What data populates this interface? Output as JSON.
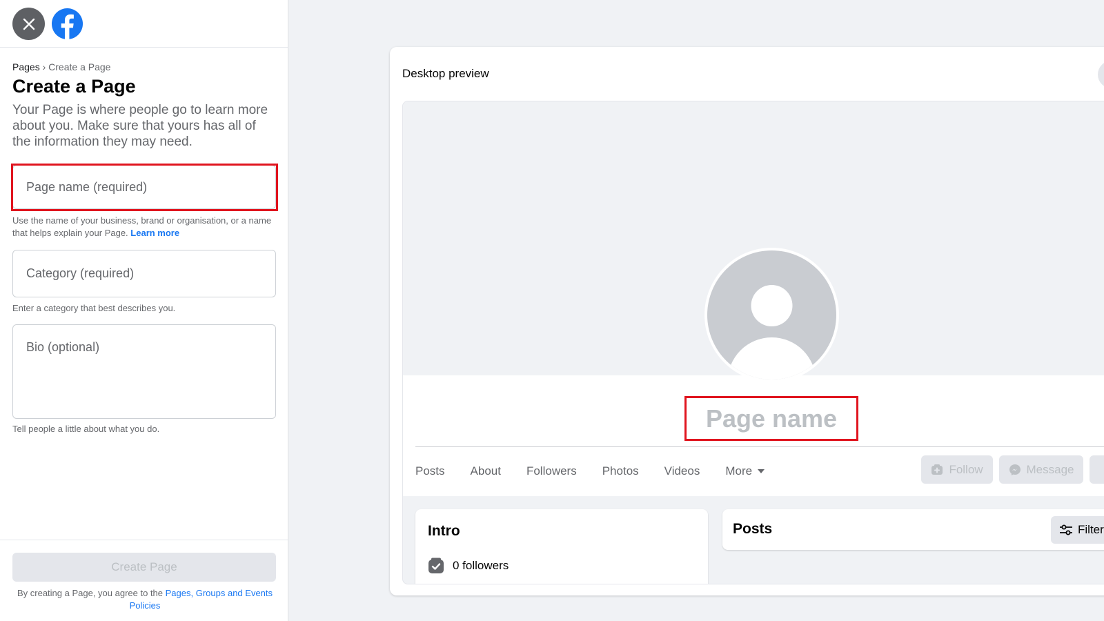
{
  "sidebar": {
    "breadcrumb": {
      "root": "Pages",
      "separator": "›",
      "current": "Create a Page"
    },
    "title": "Create a Page",
    "description": "Your Page is where people go to learn more about you. Make sure that yours has all of the information they may need.",
    "page_name": {
      "placeholder": "Page name (required)",
      "value": ""
    },
    "page_name_help": "Use the name of your business, brand or organisation, or a name that helps explain your Page.",
    "page_name_help_link": "Learn more",
    "category": {
      "placeholder": "Category (required)",
      "value": ""
    },
    "category_help": "Enter a category that best describes you.",
    "bio": {
      "placeholder": "Bio (optional)",
      "value": ""
    },
    "bio_help": "Tell people a little about what you do.",
    "create_button": "Create Page",
    "terms_prefix": "By creating a Page, you agree to the",
    "terms_link": "Pages, Groups and Events Policies"
  },
  "preview": {
    "title": "Desktop preview",
    "page_name": "Page name",
    "tabs": [
      "Posts",
      "About",
      "Followers",
      "Photos",
      "Videos"
    ],
    "more_tab": "More",
    "follow_button": "Follow",
    "message_button": "Message",
    "intro_title": "Intro",
    "followers_text": "0 followers",
    "posts_title": "Posts",
    "filters_button": "Filters"
  },
  "icons": {
    "close": "close-icon",
    "logo": "facebook-logo-icon",
    "avatar": "default-avatar-icon",
    "follow": "follow-icon",
    "message": "messenger-icon",
    "followers": "followers-check-icon",
    "filters": "filters-sliders-icon"
  },
  "colors": {
    "brand": "#1877f2",
    "highlight": "#e0141e",
    "close_button": "#5e6064",
    "disabled_text": "#bcc0c4",
    "background": "#f0f2f5"
  }
}
